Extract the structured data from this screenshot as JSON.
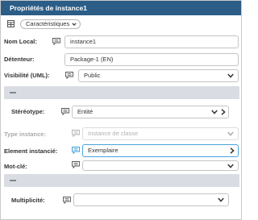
{
  "panel": {
    "title": "Propriétés de instance1"
  },
  "toolbar": {
    "grid_icon": "grid-icon",
    "dropdown_label": "Caractéristiques"
  },
  "fields": {
    "nom_local": {
      "label": "Nom Local:",
      "value": "instance1"
    },
    "detenteur": {
      "label": "Détenteur:",
      "value": "Package-1 (EN)"
    },
    "visibilite": {
      "label": "Visibilité (UML):",
      "value": "Public"
    },
    "stereotype": {
      "label": "Stéréotype:",
      "value": "Entité"
    },
    "type_instance": {
      "label": "Type instance:",
      "placeholder": "Instance de classe"
    },
    "element_instancie": {
      "label": "Element instancié:",
      "value": "Exemplaire"
    },
    "mot_cle": {
      "label": "Mot-clé:",
      "value": ""
    },
    "multiplicite": {
      "label": "Multiplicité:",
      "value": ""
    }
  },
  "icons": {
    "comment": "comment-icon",
    "dropdown": "chevron-down-icon",
    "navigate": "chevron-right-icon",
    "collapse": "minus-icon"
  },
  "colors": {
    "title_bg": "#2b5d86",
    "section_bar": "#d9dde3",
    "highlight_border": "#4aa3df"
  }
}
